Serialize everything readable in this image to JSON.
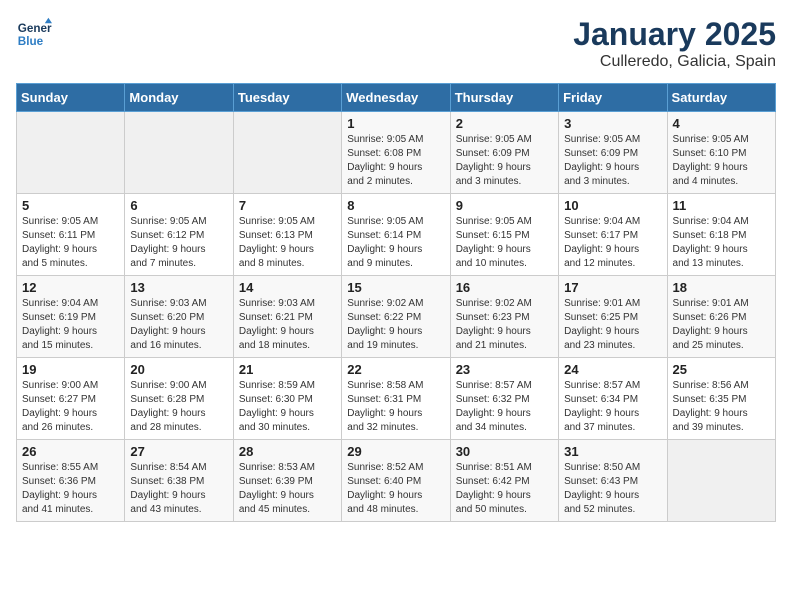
{
  "logo": {
    "line1": "General",
    "line2": "Blue"
  },
  "title": "January 2025",
  "subtitle": "Culleredo, Galicia, Spain",
  "headers": [
    "Sunday",
    "Monday",
    "Tuesday",
    "Wednesday",
    "Thursday",
    "Friday",
    "Saturday"
  ],
  "weeks": [
    [
      {
        "day": "",
        "info": ""
      },
      {
        "day": "",
        "info": ""
      },
      {
        "day": "",
        "info": ""
      },
      {
        "day": "1",
        "info": "Sunrise: 9:05 AM\nSunset: 6:08 PM\nDaylight: 9 hours\nand 2 minutes."
      },
      {
        "day": "2",
        "info": "Sunrise: 9:05 AM\nSunset: 6:09 PM\nDaylight: 9 hours\nand 3 minutes."
      },
      {
        "day": "3",
        "info": "Sunrise: 9:05 AM\nSunset: 6:09 PM\nDaylight: 9 hours\nand 3 minutes."
      },
      {
        "day": "4",
        "info": "Sunrise: 9:05 AM\nSunset: 6:10 PM\nDaylight: 9 hours\nand 4 minutes."
      }
    ],
    [
      {
        "day": "5",
        "info": "Sunrise: 9:05 AM\nSunset: 6:11 PM\nDaylight: 9 hours\nand 5 minutes."
      },
      {
        "day": "6",
        "info": "Sunrise: 9:05 AM\nSunset: 6:12 PM\nDaylight: 9 hours\nand 7 minutes."
      },
      {
        "day": "7",
        "info": "Sunrise: 9:05 AM\nSunset: 6:13 PM\nDaylight: 9 hours\nand 8 minutes."
      },
      {
        "day": "8",
        "info": "Sunrise: 9:05 AM\nSunset: 6:14 PM\nDaylight: 9 hours\nand 9 minutes."
      },
      {
        "day": "9",
        "info": "Sunrise: 9:05 AM\nSunset: 6:15 PM\nDaylight: 9 hours\nand 10 minutes."
      },
      {
        "day": "10",
        "info": "Sunrise: 9:04 AM\nSunset: 6:17 PM\nDaylight: 9 hours\nand 12 minutes."
      },
      {
        "day": "11",
        "info": "Sunrise: 9:04 AM\nSunset: 6:18 PM\nDaylight: 9 hours\nand 13 minutes."
      }
    ],
    [
      {
        "day": "12",
        "info": "Sunrise: 9:04 AM\nSunset: 6:19 PM\nDaylight: 9 hours\nand 15 minutes."
      },
      {
        "day": "13",
        "info": "Sunrise: 9:03 AM\nSunset: 6:20 PM\nDaylight: 9 hours\nand 16 minutes."
      },
      {
        "day": "14",
        "info": "Sunrise: 9:03 AM\nSunset: 6:21 PM\nDaylight: 9 hours\nand 18 minutes."
      },
      {
        "day": "15",
        "info": "Sunrise: 9:02 AM\nSunset: 6:22 PM\nDaylight: 9 hours\nand 19 minutes."
      },
      {
        "day": "16",
        "info": "Sunrise: 9:02 AM\nSunset: 6:23 PM\nDaylight: 9 hours\nand 21 minutes."
      },
      {
        "day": "17",
        "info": "Sunrise: 9:01 AM\nSunset: 6:25 PM\nDaylight: 9 hours\nand 23 minutes."
      },
      {
        "day": "18",
        "info": "Sunrise: 9:01 AM\nSunset: 6:26 PM\nDaylight: 9 hours\nand 25 minutes."
      }
    ],
    [
      {
        "day": "19",
        "info": "Sunrise: 9:00 AM\nSunset: 6:27 PM\nDaylight: 9 hours\nand 26 minutes."
      },
      {
        "day": "20",
        "info": "Sunrise: 9:00 AM\nSunset: 6:28 PM\nDaylight: 9 hours\nand 28 minutes."
      },
      {
        "day": "21",
        "info": "Sunrise: 8:59 AM\nSunset: 6:30 PM\nDaylight: 9 hours\nand 30 minutes."
      },
      {
        "day": "22",
        "info": "Sunrise: 8:58 AM\nSunset: 6:31 PM\nDaylight: 9 hours\nand 32 minutes."
      },
      {
        "day": "23",
        "info": "Sunrise: 8:57 AM\nSunset: 6:32 PM\nDaylight: 9 hours\nand 34 minutes."
      },
      {
        "day": "24",
        "info": "Sunrise: 8:57 AM\nSunset: 6:34 PM\nDaylight: 9 hours\nand 37 minutes."
      },
      {
        "day": "25",
        "info": "Sunrise: 8:56 AM\nSunset: 6:35 PM\nDaylight: 9 hours\nand 39 minutes."
      }
    ],
    [
      {
        "day": "26",
        "info": "Sunrise: 8:55 AM\nSunset: 6:36 PM\nDaylight: 9 hours\nand 41 minutes."
      },
      {
        "day": "27",
        "info": "Sunrise: 8:54 AM\nSunset: 6:38 PM\nDaylight: 9 hours\nand 43 minutes."
      },
      {
        "day": "28",
        "info": "Sunrise: 8:53 AM\nSunset: 6:39 PM\nDaylight: 9 hours\nand 45 minutes."
      },
      {
        "day": "29",
        "info": "Sunrise: 8:52 AM\nSunset: 6:40 PM\nDaylight: 9 hours\nand 48 minutes."
      },
      {
        "day": "30",
        "info": "Sunrise: 8:51 AM\nSunset: 6:42 PM\nDaylight: 9 hours\nand 50 minutes."
      },
      {
        "day": "31",
        "info": "Sunrise: 8:50 AM\nSunset: 6:43 PM\nDaylight: 9 hours\nand 52 minutes."
      },
      {
        "day": "",
        "info": ""
      }
    ]
  ]
}
